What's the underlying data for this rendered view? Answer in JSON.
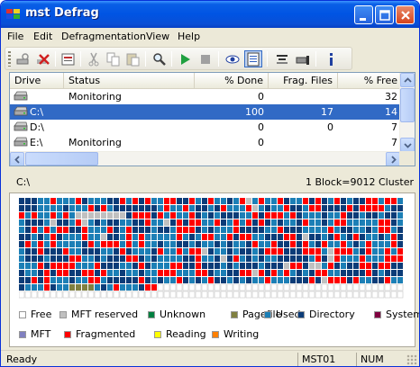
{
  "window": {
    "title": "mst Defrag"
  },
  "menu": [
    "File",
    "Edit",
    "Defragmentation",
    "View",
    "Help"
  ],
  "toolbar": {
    "tools": [
      {
        "name": "analyze-icon"
      },
      {
        "name": "stop-cross-icon"
      },
      {
        "name": "report-icon"
      },
      {
        "name": "cut-icon"
      },
      {
        "name": "copy-icon"
      },
      {
        "name": "paste-icon"
      },
      {
        "name": "find-icon"
      },
      {
        "name": "play-icon"
      },
      {
        "name": "stop-icon"
      },
      {
        "name": "eye-icon"
      },
      {
        "name": "list-view-icon"
      },
      {
        "name": "options-icon"
      },
      {
        "name": "drive-options-icon"
      },
      {
        "name": "about-icon"
      }
    ]
  },
  "drives": {
    "columns": [
      "Drive",
      "Status",
      "% Done",
      "Frag. Files",
      "% Free"
    ],
    "rows": [
      {
        "drive": "",
        "status": "Monitoring",
        "done": "0",
        "frag": "",
        "free": "32",
        "selected": false
      },
      {
        "drive": "C:\\",
        "status": "",
        "done": "100",
        "frag": "17",
        "free": "14",
        "selected": true
      },
      {
        "drive": "D:\\",
        "status": "",
        "done": "0",
        "frag": "0",
        "free": "7",
        "selected": false
      },
      {
        "drive": "E:\\",
        "status": "Monitoring",
        "done": "0",
        "frag": "",
        "free": "7",
        "selected": false
      }
    ]
  },
  "map": {
    "drive": "C:\\",
    "block_info": "1 Block=9012 Cluster"
  },
  "legend": [
    {
      "label": "Free",
      "color": "#ffffff"
    },
    {
      "label": "MFT reserved",
      "color": "#c0c0c0"
    },
    {
      "label": "Unknown",
      "color": "#008040"
    },
    {
      "label": "Pagefile",
      "color": "#808040"
    },
    {
      "label": "Used",
      "color": "#1c7fb6"
    },
    {
      "label": "Directory",
      "color": "#0c3c78"
    },
    {
      "label": "System",
      "color": "#800040"
    },
    {
      "label": "MFT",
      "color": "#8080c0"
    },
    {
      "label": "Fragmented",
      "color": "#ff0000"
    },
    {
      "label": "Reading",
      "color": "#ffff00"
    },
    {
      "label": "Writing",
      "color": "#ff8000"
    }
  ],
  "status": {
    "text": "Ready",
    "machine": "MST01",
    "num": "NUM"
  }
}
